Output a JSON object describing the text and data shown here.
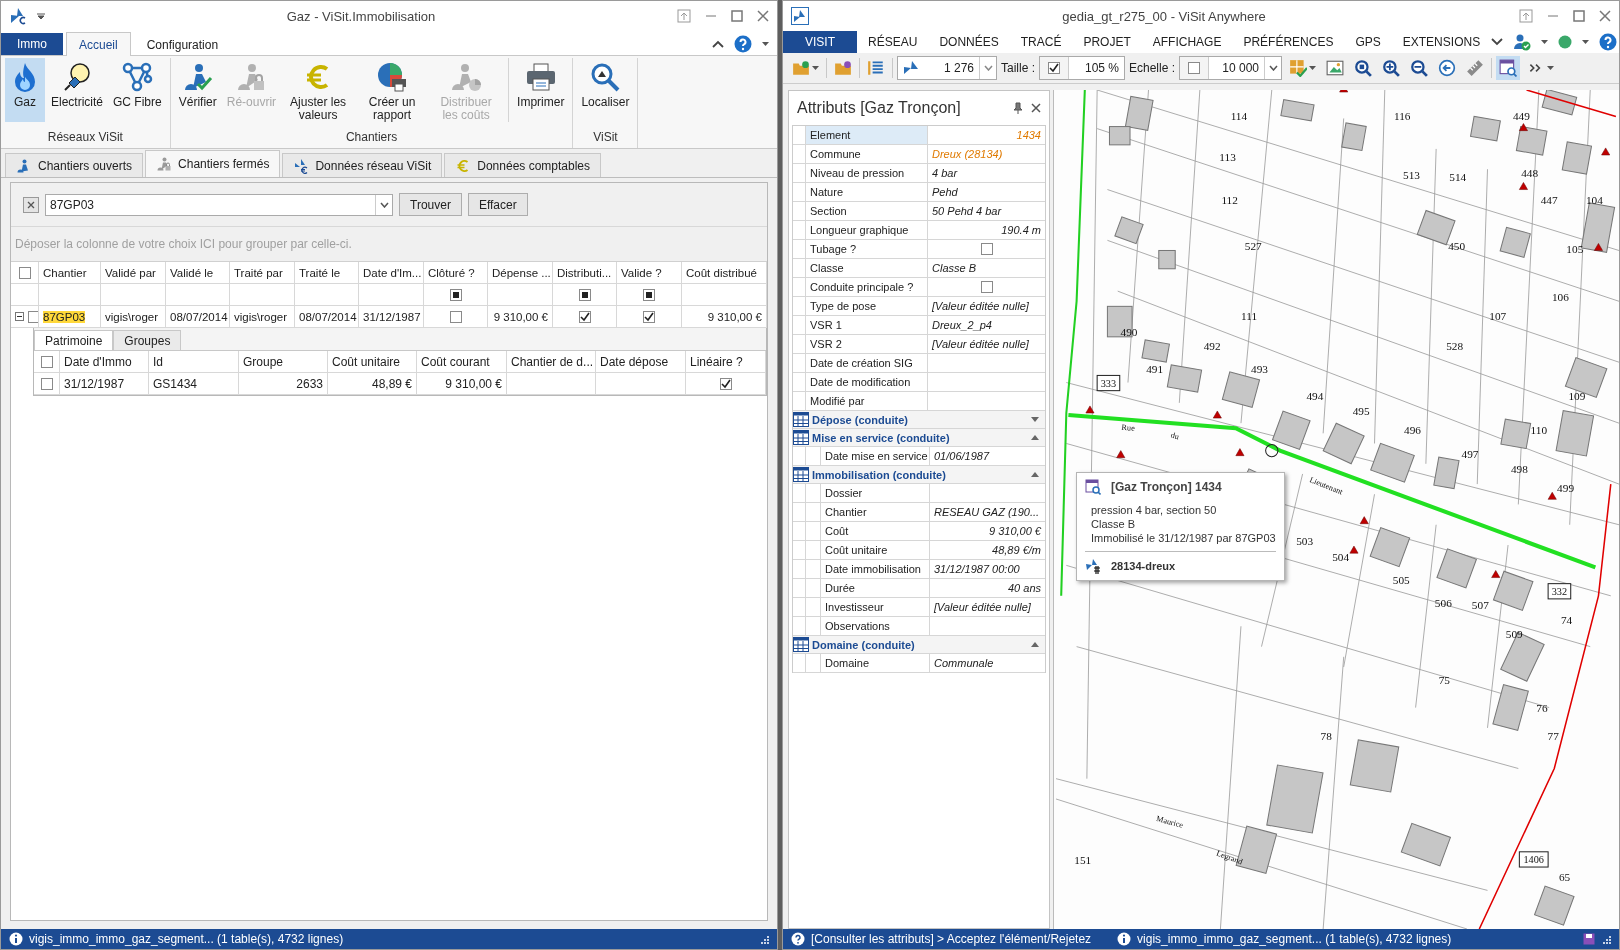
{
  "left_window": {
    "title": "Gaz - ViSit.Immobilisation",
    "ribbon": {
      "app_tab": "Immo",
      "tabs": [
        {
          "label": "Accueil",
          "selected": true
        },
        {
          "label": "Configuration",
          "selected": false
        }
      ],
      "groups": [
        {
          "label": "Réseaux ViSit",
          "buttons": [
            {
              "label": "Gaz",
              "selected": true,
              "disabled": false
            },
            {
              "label": "Electricité",
              "selected": false,
              "disabled": false
            },
            {
              "label": "GC Fibre",
              "selected": false,
              "disabled": false
            }
          ]
        },
        {
          "label": "Chantiers",
          "buttons": [
            {
              "label": "Vérifier",
              "selected": false,
              "disabled": false
            },
            {
              "label": "Ré-ouvrir",
              "selected": false,
              "disabled": true
            },
            {
              "label": "Ajuster les valeurs",
              "selected": false,
              "disabled": false
            },
            {
              "label": "Créer un rapport",
              "selected": false,
              "disabled": false
            },
            {
              "label": "Distribuer les coûts",
              "selected": false,
              "disabled": true
            },
            {
              "label": "Imprimer",
              "selected": false,
              "disabled": false
            }
          ]
        },
        {
          "label": "ViSit",
          "buttons": [
            {
              "label": "Localiser",
              "selected": false,
              "disabled": false
            }
          ]
        }
      ]
    },
    "doc_tabs": [
      {
        "label": "Chantiers ouverts",
        "selected": false
      },
      {
        "label": "Chantiers fermés",
        "selected": true
      },
      {
        "label": "Données réseau ViSit",
        "selected": false
      },
      {
        "label": "Données comptables",
        "selected": false
      }
    ],
    "search": {
      "value": "87GP03",
      "buttons": [
        "Trouver",
        "Effacer"
      ]
    },
    "group_hint": "Déposer la colonne de votre choix ICI pour grouper par celle-ci.",
    "grid": {
      "all_checked": false,
      "columns": [
        {
          "label": "Chantier",
          "filter_check": false
        },
        {
          "label": "Validé par",
          "filter_check": false
        },
        {
          "label": "Validé le",
          "filter_check": false
        },
        {
          "label": "Traité par",
          "filter_check": false
        },
        {
          "label": "Traité le",
          "filter_check": false
        },
        {
          "label": "Date d'Im...",
          "filter_check": false
        },
        {
          "label": "Clôturé ?",
          "filter_check": true
        },
        {
          "label": "Dépense ...",
          "filter_check": false
        },
        {
          "label": "Distributi...",
          "filter_check": true
        },
        {
          "label": "Valide ?",
          "filter_check": true
        },
        {
          "label": "Coût distribué",
          "filter_check": false
        }
      ],
      "rows": [
        {
          "expanded": true,
          "checked": false,
          "cells": [
            {
              "kind": "text",
              "text": "87GP03",
              "highlight": true,
              "numeric": false
            },
            {
              "kind": "text",
              "text": "vigis\\roger",
              "highlight": false,
              "numeric": false
            },
            {
              "kind": "text",
              "text": "08/07/2014",
              "highlight": false,
              "numeric": false
            },
            {
              "kind": "text",
              "text": "vigis\\roger",
              "highlight": false,
              "numeric": false
            },
            {
              "kind": "text",
              "text": "08/07/2014",
              "highlight": false,
              "numeric": false
            },
            {
              "kind": "text",
              "text": "31/12/1987",
              "highlight": false,
              "numeric": false
            },
            {
              "kind": "check",
              "checked": false
            },
            {
              "kind": "text",
              "text": "9 310,00 €",
              "highlight": false,
              "numeric": true
            },
            {
              "kind": "check",
              "checked": true
            },
            {
              "kind": "check",
              "checked": true
            },
            {
              "kind": "text",
              "text": "9 310,00 €",
              "highlight": false,
              "numeric": true
            }
          ],
          "detail": {
            "tabs": [
              {
                "label": "Patrimoine",
                "selected": true
              },
              {
                "label": "Groupes",
                "selected": false
              }
            ],
            "all_checked": false,
            "columns": [
              {
                "label": "Date d'Immo"
              },
              {
                "label": "Id"
              },
              {
                "label": "Groupe"
              },
              {
                "label": "Coût unitaire"
              },
              {
                "label": "Coût courant"
              },
              {
                "label": "Chantier de d..."
              },
              {
                "label": "Date dépose"
              },
              {
                "label": "Linéaire ?"
              }
            ],
            "rows": [
              {
                "checked": false,
                "cells": [
                  {
                    "kind": "text",
                    "text": "31/12/1987",
                    "numeric": false
                  },
                  {
                    "kind": "text",
                    "text": "GS1434",
                    "numeric": false
                  },
                  {
                    "kind": "text",
                    "text": "2633",
                    "numeric": true
                  },
                  {
                    "kind": "text",
                    "text": "48,89 €",
                    "numeric": true
                  },
                  {
                    "kind": "text",
                    "text": "9 310,00 €",
                    "numeric": true
                  },
                  {
                    "kind": "empty"
                  },
                  {
                    "kind": "empty"
                  },
                  {
                    "kind": "check",
                    "checked": true
                  }
                ]
              }
            ]
          }
        }
      ]
    },
    "status": "vigis_immo_immo_gaz_segment... (1 table(s), 4732 lignes)"
  },
  "right_window": {
    "title": "gedia_gt_r275_00 - ViSit Anywhere",
    "menu": [
      {
        "label": "VISIT",
        "selected": true
      },
      {
        "label": "RÉSEAU",
        "selected": false
      },
      {
        "label": "DONNÉES",
        "selected": false
      },
      {
        "label": "TRACÉ",
        "selected": false
      },
      {
        "label": "PROJET",
        "selected": false
      },
      {
        "label": "AFFICHAGE",
        "selected": false
      },
      {
        "label": "PRÉFÉRENCES",
        "selected": false
      },
      {
        "label": "GPS",
        "selected": false
      },
      {
        "label": "EXTENSIONS",
        "selected": false
      }
    ],
    "toolbar": [
      {
        "kind": "button",
        "dropdown": true,
        "selected": false
      },
      {
        "kind": "separator"
      },
      {
        "kind": "button",
        "dropdown": false,
        "selected": false
      },
      {
        "kind": "separator"
      },
      {
        "kind": "button",
        "dropdown": false,
        "selected": false
      },
      {
        "kind": "separator"
      },
      {
        "kind": "combo",
        "value": "1 276"
      },
      {
        "kind": "label",
        "text": "Taille :"
      },
      {
        "kind": "check-field",
        "checked": true,
        "value": "105 %",
        "dropdown": false
      },
      {
        "kind": "label",
        "text": "Echelle :"
      },
      {
        "kind": "check-field",
        "checked": false,
        "value": "10 000",
        "dropdown": true
      },
      {
        "kind": "button",
        "dropdown": true,
        "selected": false
      },
      {
        "kind": "button",
        "dropdown": false,
        "selected": false
      },
      {
        "kind": "button",
        "dropdown": false,
        "selected": false
      },
      {
        "kind": "button",
        "dropdown": false,
        "selected": false
      },
      {
        "kind": "button",
        "dropdown": false,
        "selected": false
      },
      {
        "kind": "button",
        "dropdown": false,
        "selected": false
      },
      {
        "kind": "button",
        "dropdown": false,
        "selected": false
      },
      {
        "kind": "separator"
      },
      {
        "kind": "button",
        "dropdown": false,
        "selected": true
      },
      {
        "kind": "button",
        "dropdown": true,
        "selected": false
      }
    ],
    "attributes": {
      "title": "Attributs [Gaz Tronçon]",
      "rows": [
        {
          "kind": "field",
          "label": "Element",
          "value": "1434",
          "numeric": true,
          "link": true,
          "selected": true
        },
        {
          "kind": "field",
          "label": "Commune",
          "value": "Dreux (28134)",
          "numeric": false,
          "link": true,
          "selected": false
        },
        {
          "kind": "field",
          "label": "Niveau de pression",
          "value": "4 bar",
          "numeric": false,
          "link": false,
          "selected": false
        },
        {
          "kind": "field",
          "label": "Nature",
          "value": "Pehd",
          "numeric": false,
          "link": false,
          "selected": false
        },
        {
          "kind": "field",
          "label": "Section",
          "value": "50 Pehd 4 bar",
          "numeric": false,
          "link": false,
          "selected": false
        },
        {
          "kind": "field",
          "label": "Longueur graphique",
          "value": "190.4 m",
          "numeric": true,
          "link": false,
          "selected": false
        },
        {
          "kind": "check",
          "label": "Tubage ?",
          "checked": false,
          "selected": false
        },
        {
          "kind": "field",
          "label": "Classe",
          "value": "Classe B",
          "numeric": false,
          "link": false,
          "selected": false
        },
        {
          "kind": "check",
          "label": "Conduite  principale ?",
          "checked": false,
          "selected": false
        },
        {
          "kind": "field",
          "label": "Type de pose",
          "value": "[Valeur éditée nulle]",
          "numeric": false,
          "link": false,
          "selected": false
        },
        {
          "kind": "field",
          "label": "VSR 1",
          "value": "Dreux_2_p4",
          "numeric": false,
          "link": false,
          "selected": false
        },
        {
          "kind": "field",
          "label": "VSR 2",
          "value": "[Valeur éditée nulle]",
          "numeric": false,
          "link": false,
          "selected": false
        },
        {
          "kind": "field",
          "label": "Date de création SIG",
          "selected": false
        },
        {
          "kind": "field",
          "label": "Date de modification",
          "selected": false
        },
        {
          "kind": "field",
          "label": "Modifié par",
          "selected": false
        },
        {
          "kind": "section",
          "label": "Dépose (conduite)",
          "expanded": false
        },
        {
          "kind": "section",
          "label": "Mise en service (conduite)",
          "expanded": true,
          "children": [
            {
              "kind": "field",
              "label": "Date mise en  service",
              "value": "01/06/1987",
              "numeric": false,
              "link": false,
              "selected": false
            }
          ]
        },
        {
          "kind": "section",
          "label": "Immobilisation (conduite)",
          "expanded": true,
          "children": [
            {
              "kind": "field",
              "label": "Dossier",
              "selected": false
            },
            {
              "kind": "field",
              "label": "Chantier",
              "value": "RESEAU GAZ (190...",
              "numeric": false,
              "link": false,
              "selected": false
            },
            {
              "kind": "field",
              "label": "Coût",
              "value": "9 310,00 €",
              "numeric": true,
              "link": false,
              "selected": false
            },
            {
              "kind": "field",
              "label": "Coût unitaire",
              "value": "48,89 €/m",
              "numeric": true,
              "link": false,
              "selected": false
            },
            {
              "kind": "field",
              "label": "Date immobilisation",
              "value": "31/12/1987 00:00",
              "numeric": false,
              "link": false,
              "selected": false
            },
            {
              "kind": "field",
              "label": "Durée",
              "value": "40 ans",
              "numeric": true,
              "link": false,
              "selected": false
            },
            {
              "kind": "field",
              "label": "Investisseur",
              "value": "[Valeur éditée nulle]",
              "numeric": false,
              "link": false,
              "selected": false
            },
            {
              "kind": "field",
              "label": "Observations",
              "selected": false
            }
          ]
        },
        {
          "kind": "section",
          "label": "Domaine (conduite)",
          "expanded": true,
          "children": [
            {
              "kind": "field",
              "label": "Domaine",
              "value": "Communale",
              "numeric": false,
              "link": false,
              "selected": false
            }
          ]
        }
      ]
    },
    "map": {
      "parcels": [
        "114",
        "116",
        "449",
        "113",
        "513",
        "514",
        "448",
        "112",
        "447",
        "104",
        "527",
        "450",
        "105",
        "106",
        "111",
        "107",
        "490",
        "492",
        "528",
        "491",
        "493",
        "494",
        "109",
        "495",
        "496",
        "110",
        "497",
        "498",
        "499",
        "503",
        "504",
        "505",
        "506",
        "507",
        "74",
        "509",
        "75",
        "76",
        "78",
        "77",
        "151",
        "65"
      ],
      "streets": [
        "Rue",
        "du",
        "Lieutenant",
        "Maurice",
        "Legrand"
      ],
      "nodes": [
        "333",
        "332",
        "1406"
      ],
      "tooltip": {
        "title": "[Gaz Tronçon] 1434",
        "lines": [
          "pression 4 bar, section 50",
          "Classe B",
          "Immobilisé le 31/12/1987 par 87GP03"
        ],
        "footer": "28134-dreux"
      }
    },
    "status": {
      "hint": "[Consulter les attributs] > Acceptez l'élément/Rejetez",
      "info": "vigis_immo_immo_gaz_segment... (1 table(s), 4732 lignes)"
    }
  }
}
